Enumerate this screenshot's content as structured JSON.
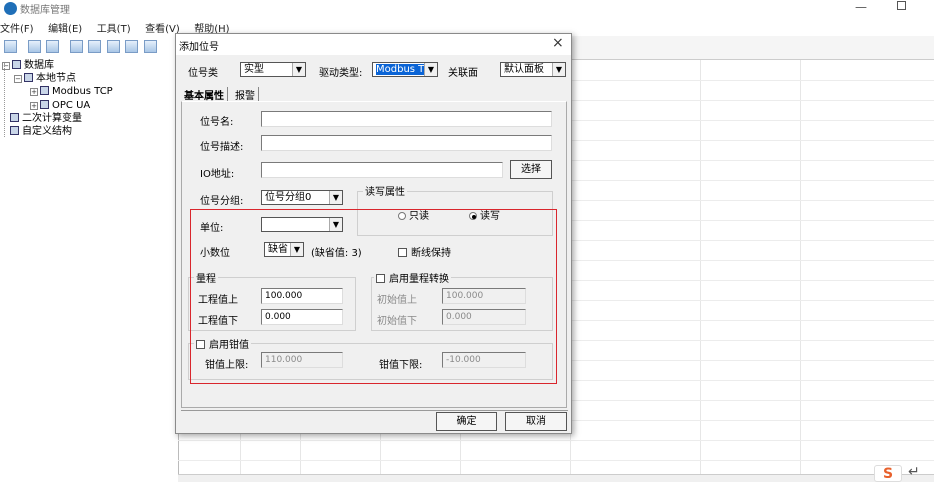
{
  "app": {
    "title": "数据库管理"
  },
  "menu": [
    "文件(F)",
    "编辑(E)",
    "工具(T)",
    "查看(V)",
    "帮助(H)"
  ],
  "tree": {
    "root": "数据库",
    "local_node": "本地节点",
    "modbus": "Modbus TCP",
    "opcua": "OPC UA",
    "calc_vars": "二次计算变量",
    "custom_struct": "自定义结构"
  },
  "dialog": {
    "title": "添加位号",
    "close": "×",
    "tag_type_label": "位号类",
    "tag_type_value": "实型",
    "driver_type_label": "驱动类型:",
    "driver_type_value": "Modbus TCP",
    "panel_label": "关联面",
    "panel_value": "默认面板",
    "tabs": [
      "基本属性",
      "报警"
    ],
    "name_label": "位号名:",
    "desc_label": "位号描述:",
    "io_label": "IO地址:",
    "select_button": "选择",
    "group_label": "位号分组:",
    "group_value": "位号分组0",
    "rw": {
      "caption": "读写属性",
      "read_only": "只读",
      "read_write": "读写",
      "selected": "读写"
    },
    "unit_label": "单位:",
    "unit_value": "",
    "decimal_label": "小数位",
    "decimal_value": "缺省",
    "decimal_default": "(缺省值: 3)",
    "hold_label": "断线保持",
    "range": {
      "caption": "量程",
      "upper_label": "工程值上",
      "upper_value": "100.000",
      "lower_label": "工程值下",
      "lower_value": "0.000"
    },
    "conversion": {
      "caption": "启用量程转换",
      "init_upper_label": "初始值上",
      "init_upper_value": "100.000",
      "init_lower_label": "初始值下",
      "init_lower_value": "0.000"
    },
    "clamp": {
      "caption": "启用钳值",
      "upper_label": "钳值上限:",
      "upper_value": "110.000",
      "lower_label": "钳值下限:",
      "lower_value": "-10.000"
    },
    "ok_button": "确定",
    "cancel_button": "取消"
  },
  "colors": {
    "highlight_box": "#d9262d",
    "selection": "#0a64d6"
  }
}
